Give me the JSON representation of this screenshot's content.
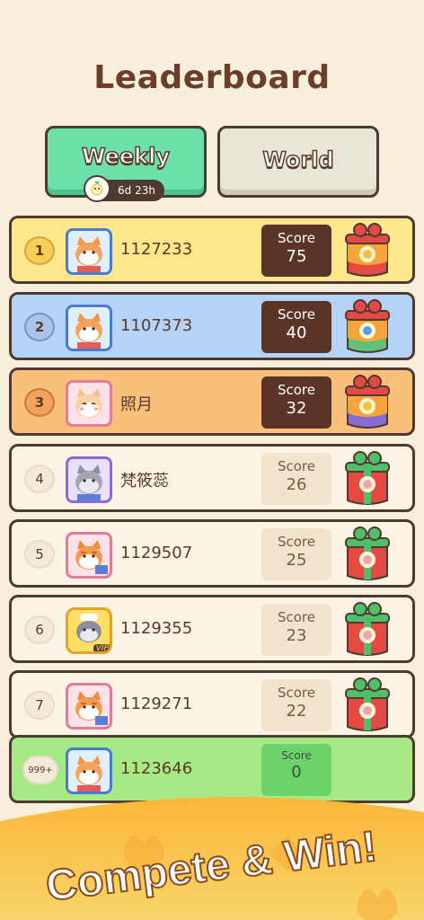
{
  "header": {
    "title": "Leaderboard"
  },
  "tabs": [
    {
      "label": "Weekly",
      "active": true
    },
    {
      "label": "World",
      "active": false
    }
  ],
  "timer": {
    "icon": "chick-icon",
    "text": "6d 23h"
  },
  "score_label": "Score",
  "rows": [
    {
      "rank": "1",
      "name": "1127233",
      "score": "75"
    },
    {
      "rank": "2",
      "name": "1107373",
      "score": "40"
    },
    {
      "rank": "3",
      "name": "照月",
      "score": "32"
    },
    {
      "rank": "4",
      "name": "梵筱蕊",
      "score": "26"
    },
    {
      "rank": "5",
      "name": "1129507",
      "score": "25"
    },
    {
      "rank": "6",
      "name": "1129355",
      "score": "23",
      "badge": "VIP"
    },
    {
      "rank": "7",
      "name": "1129271",
      "score": "22"
    }
  ],
  "my_row": {
    "rank": "999+",
    "name": "1123646",
    "score": "0"
  },
  "banner": {
    "text": "Compete & Win!"
  },
  "colors": {
    "gold": "#fde78a",
    "blue": "#b5d3f6",
    "orange": "#f9c07a",
    "me": "#a7ea85",
    "brown": "#5c3427"
  }
}
